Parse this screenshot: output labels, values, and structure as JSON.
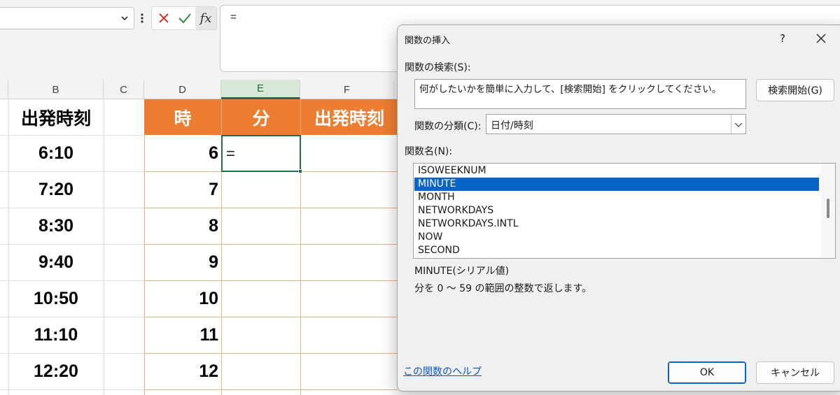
{
  "formula_bar": {
    "name_box_value": "",
    "cancel_icon": "x-icon",
    "enter_icon": "check-icon",
    "fx_label": "fx",
    "formula_text": "="
  },
  "columns": [
    {
      "letter": "B"
    },
    {
      "letter": "C"
    },
    {
      "letter": "D"
    },
    {
      "letter": "E"
    },
    {
      "letter": "F"
    }
  ],
  "sheet": {
    "b_header": "出発時刻",
    "d_header": "時",
    "e_header": "分",
    "f_header": "出発時刻",
    "active_cell_text": "=",
    "rows": [
      {
        "time": "6:10",
        "hour": "6"
      },
      {
        "time": "7:20",
        "hour": "7"
      },
      {
        "time": "8:30",
        "hour": "8"
      },
      {
        "time": "9:40",
        "hour": "9"
      },
      {
        "time": "10:50",
        "hour": "10"
      },
      {
        "time": "11:10",
        "hour": "11"
      },
      {
        "time": "12:20",
        "hour": "12"
      }
    ],
    "header_color": "#ed7d31",
    "selection_color": "#1e7145"
  },
  "dialog": {
    "title": "関数の挿入",
    "help_symbol": "?",
    "search_label": "関数の検索(S):",
    "search_text": "何がしたいかを簡単に入力して、[検索開始] をクリックしてください。",
    "search_button": "検索開始(G)",
    "category_label": "関数の分類(C):",
    "category_value": "日付/時刻",
    "function_name_label": "関数名(N):",
    "functions": [
      "ISOWEEKNUM",
      "MINUTE",
      "MONTH",
      "NETWORKDAYS",
      "NETWORKDAYS.INTL",
      "NOW",
      "SECOND"
    ],
    "selected_function": "MINUTE",
    "syntax": "MINUTE(シリアル値)",
    "description": "分を 0 ～ 59 の範囲の整数で返します。",
    "help_link": "この関数のヘルプ",
    "ok_label": "OK",
    "cancel_label": "キャンセル",
    "accent_color": "#0a64c8"
  }
}
